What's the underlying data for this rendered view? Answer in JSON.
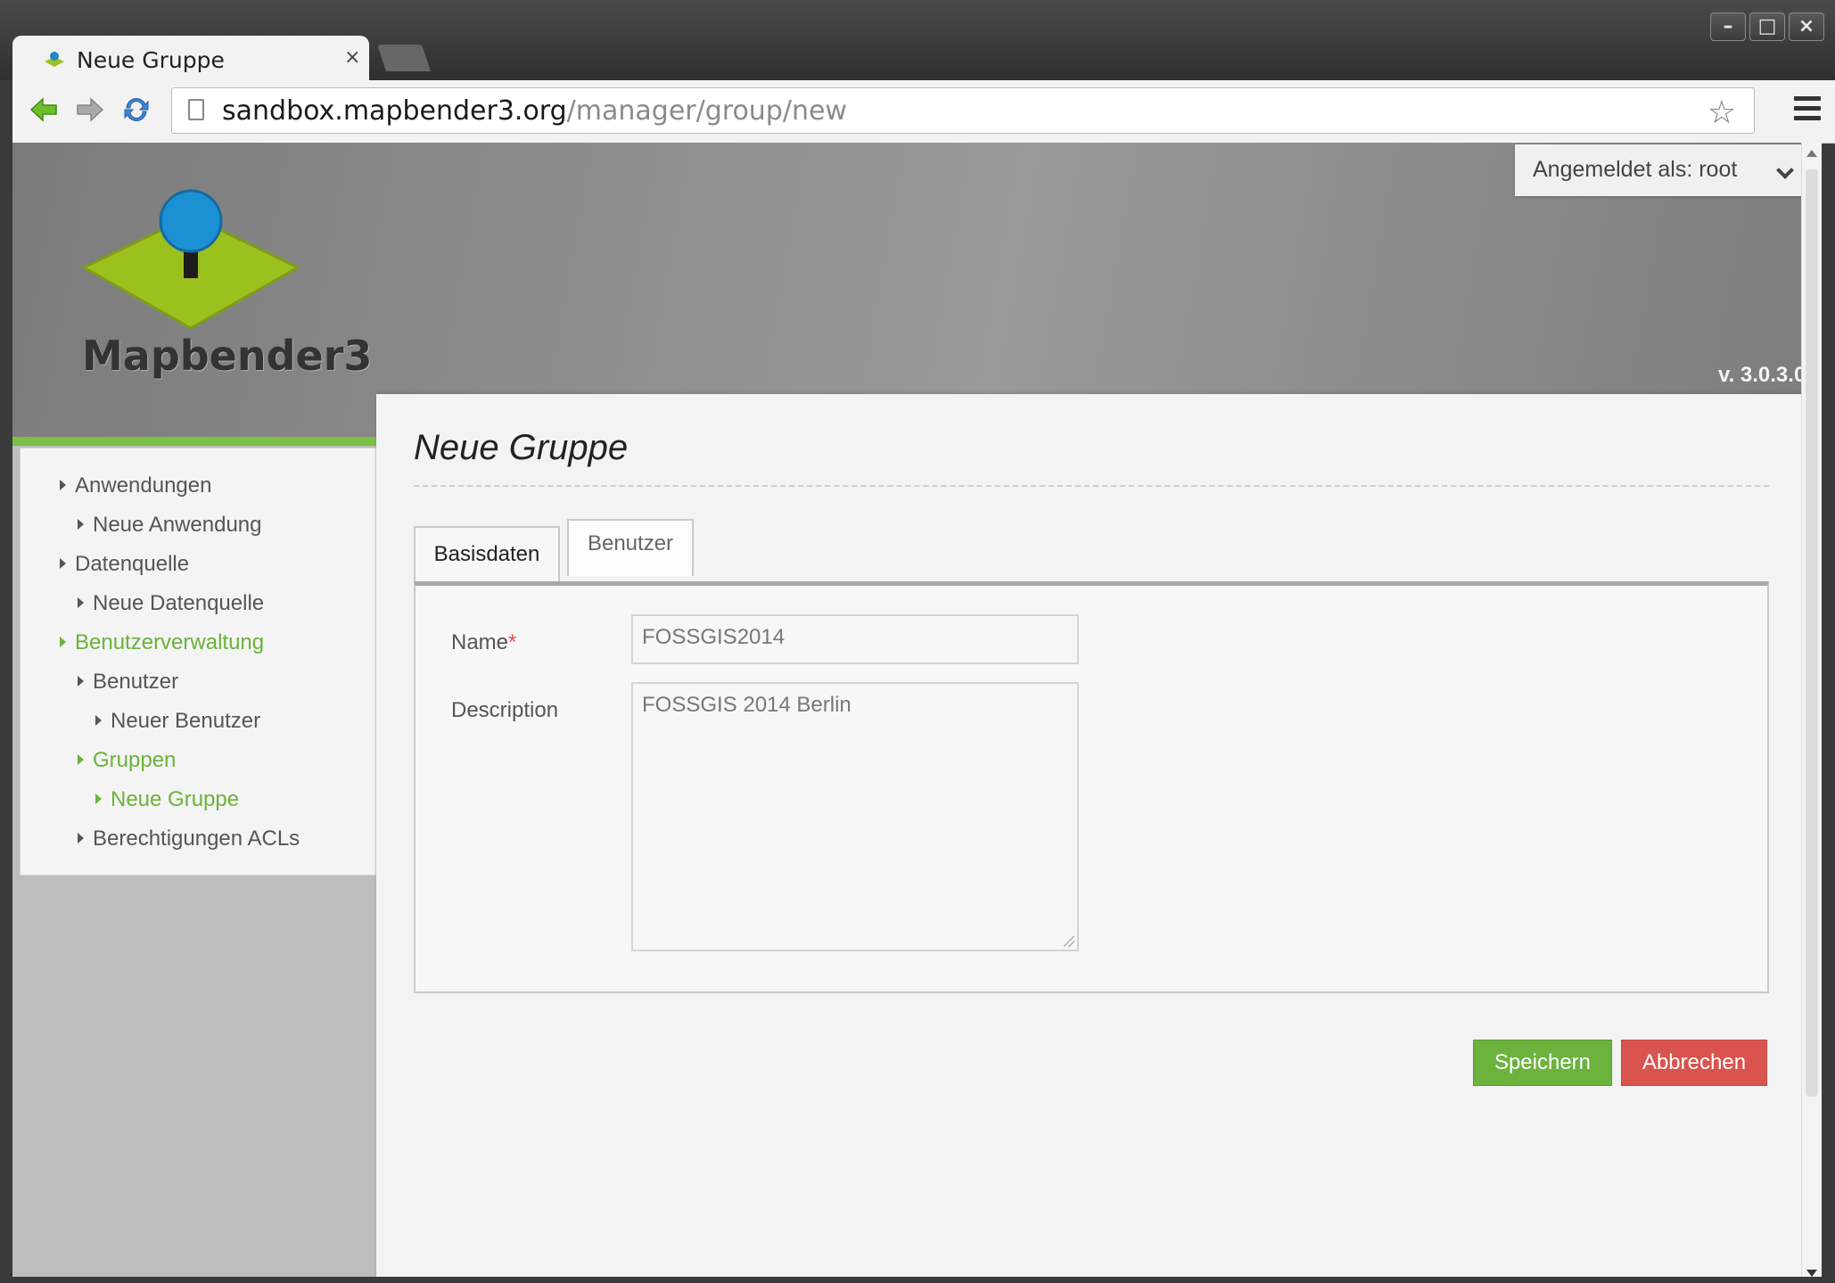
{
  "browser": {
    "tab_title": "Neue Gruppe",
    "tab_close": "×",
    "url_host": "sandbox.mapbender3.org",
    "url_path": "/manager/group/new",
    "star": "☆",
    "window_controls": {
      "minimize": "–",
      "maximize": "□",
      "close": "×"
    }
  },
  "header": {
    "logo_text": "Mapbender3",
    "user_menu_label": "Angemeldet als: root",
    "version": "v. 3.0.3.0"
  },
  "sidebar": {
    "items": [
      {
        "label": "Anwendungen",
        "level": 0,
        "active": false
      },
      {
        "label": "Neue Anwendung",
        "level": 1,
        "active": false
      },
      {
        "label": "Datenquelle",
        "level": 0,
        "active": false
      },
      {
        "label": "Neue Datenquelle",
        "level": 1,
        "active": false
      },
      {
        "label": "Benutzerverwaltung",
        "level": 0,
        "active": true
      },
      {
        "label": "Benutzer",
        "level": 1,
        "active": false
      },
      {
        "label": "Neuer Benutzer",
        "level": 2,
        "active": false
      },
      {
        "label": "Gruppen",
        "level": 1,
        "active": true
      },
      {
        "label": "Neue Gruppe",
        "level": 2,
        "active": true
      },
      {
        "label": "Berechtigungen ACLs",
        "level": 1,
        "active": false
      }
    ]
  },
  "main": {
    "title": "Neue Gruppe",
    "tabs": [
      {
        "label": "Basisdaten",
        "selected": true
      },
      {
        "label": "Benutzer",
        "selected": false
      }
    ],
    "form": {
      "name_label": "Name",
      "required_mark": "*",
      "name_value": "FOSSGIS2014",
      "description_label": "Description",
      "description_value": "FOSSGIS 2014 Berlin"
    },
    "buttons": {
      "save": "Speichern",
      "cancel": "Abbrechen"
    }
  },
  "colors": {
    "accent_green": "#6ab33a",
    "cancel_red": "#d9534f",
    "header_gray": "#8c8c8c"
  }
}
